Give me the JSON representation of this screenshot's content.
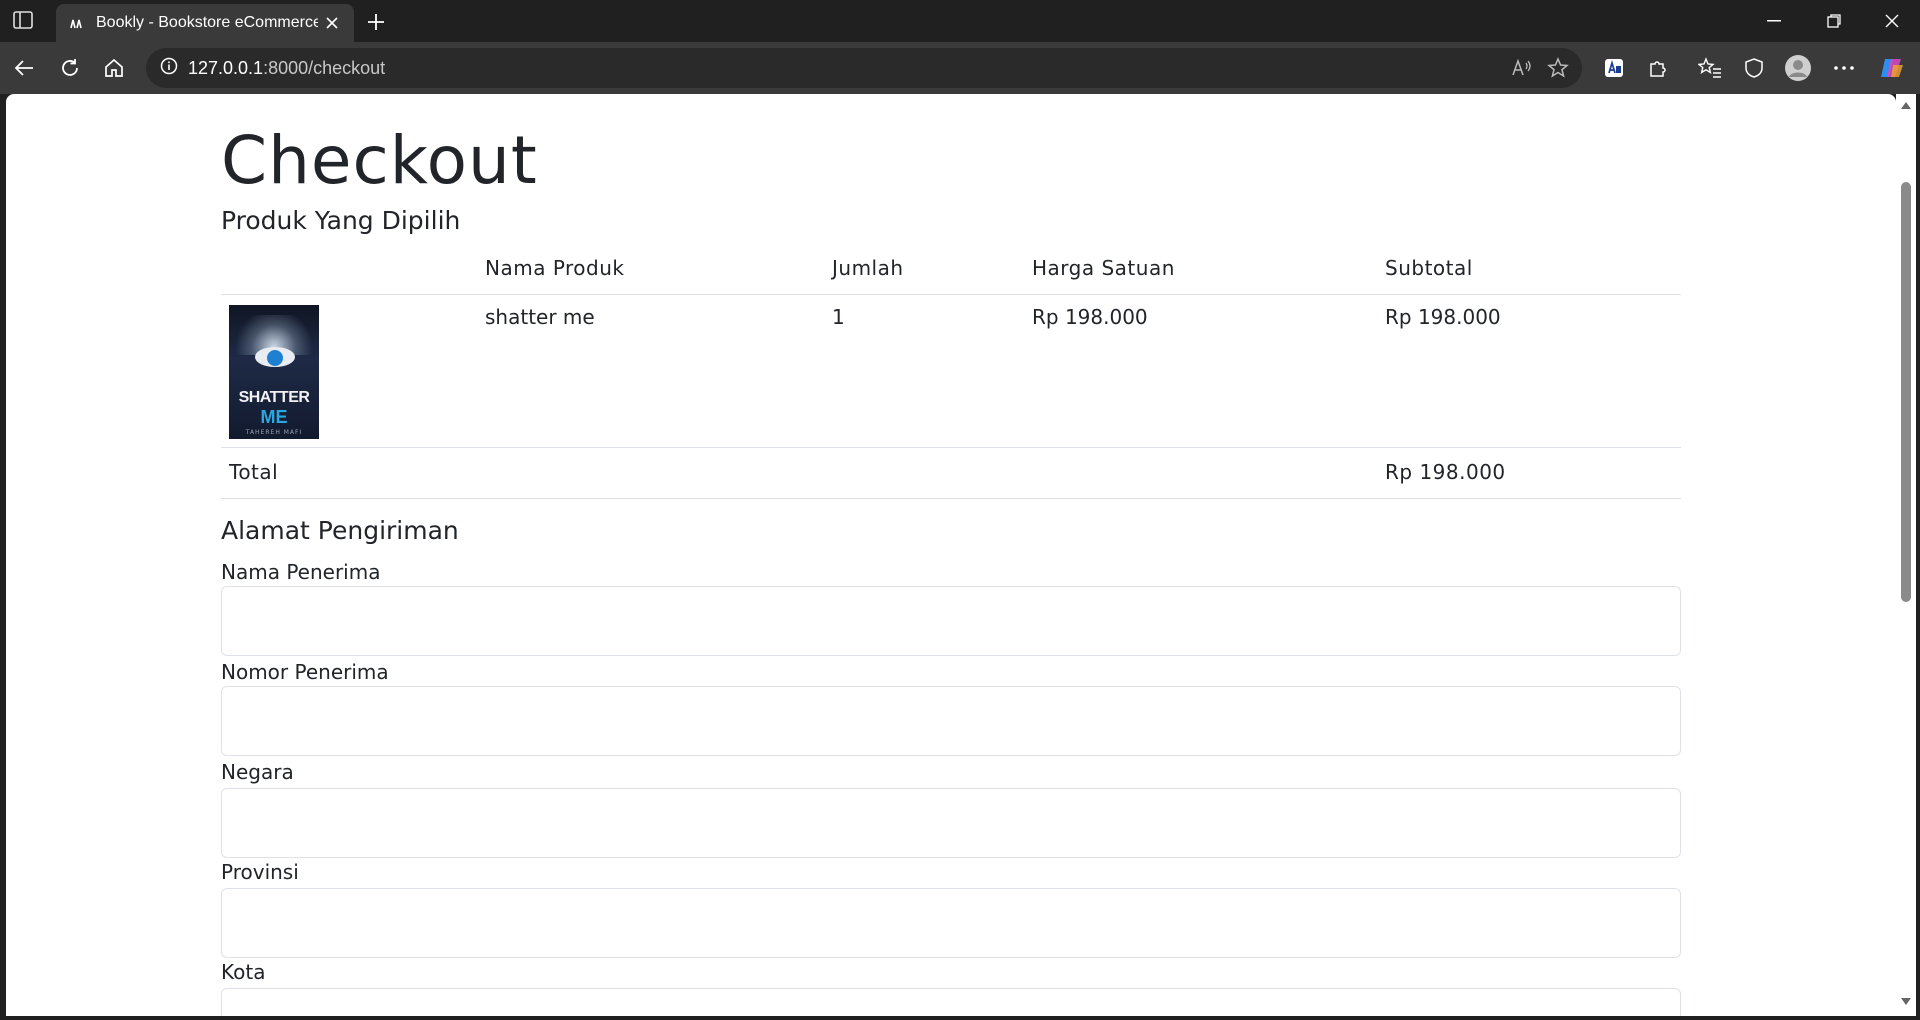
{
  "browser": {
    "tab_title": "Bookly - Bookstore eCommerce W",
    "url_host": "127.0.0.1",
    "url_path": ":8000/checkout"
  },
  "page": {
    "title": "Checkout",
    "products_heading": "Produk Yang Dipilih",
    "table": {
      "headers": [
        "",
        "Nama Produk",
        "Jumlah",
        "Harga Satuan",
        "Subtotal"
      ],
      "rows": [
        {
          "cover_title_1": "SHATTER",
          "cover_title_2": "ME",
          "cover_author": "TAHEREH MAFI",
          "name": "shatter me",
          "qty": "1",
          "unit_price": "Rp 198.000",
          "subtotal": "Rp 198.000"
        }
      ],
      "total_label": "Total",
      "total_value": "Rp 198.000"
    },
    "shipping_heading": "Alamat Pengiriman",
    "fields": [
      {
        "label": "Nama Penerima",
        "value": ""
      },
      {
        "label": "Nomor Penerima",
        "value": ""
      },
      {
        "label": "Negara",
        "value": ""
      },
      {
        "label": "Provinsi",
        "value": ""
      },
      {
        "label": "Kota",
        "value": ""
      }
    ]
  }
}
